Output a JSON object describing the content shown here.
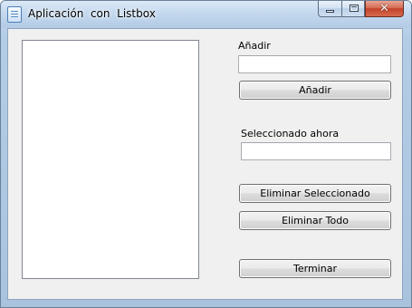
{
  "window": {
    "title": "Aplicación  con  Listbox",
    "close_glyph": "✕"
  },
  "form": {
    "add_label": "Añadir",
    "add_input_value": "",
    "add_button": "Añadir",
    "selected_label": "Seleccionado ahora",
    "selected_input_value": "",
    "delete_selected_button": "Eliminar Seleccionado",
    "delete_all_button": "Eliminar Todo",
    "finish_button": "Terminar"
  },
  "listbox": {
    "items": []
  },
  "colors": {
    "client_background": "#f0f0f0",
    "close_button_red": "#c4422a",
    "titlebar_blue": "#c3d8ee"
  },
  "icons": {
    "app": "window-app-icon",
    "minimize": "minimize-icon",
    "maximize": "maximize-icon",
    "close": "close-icon"
  }
}
